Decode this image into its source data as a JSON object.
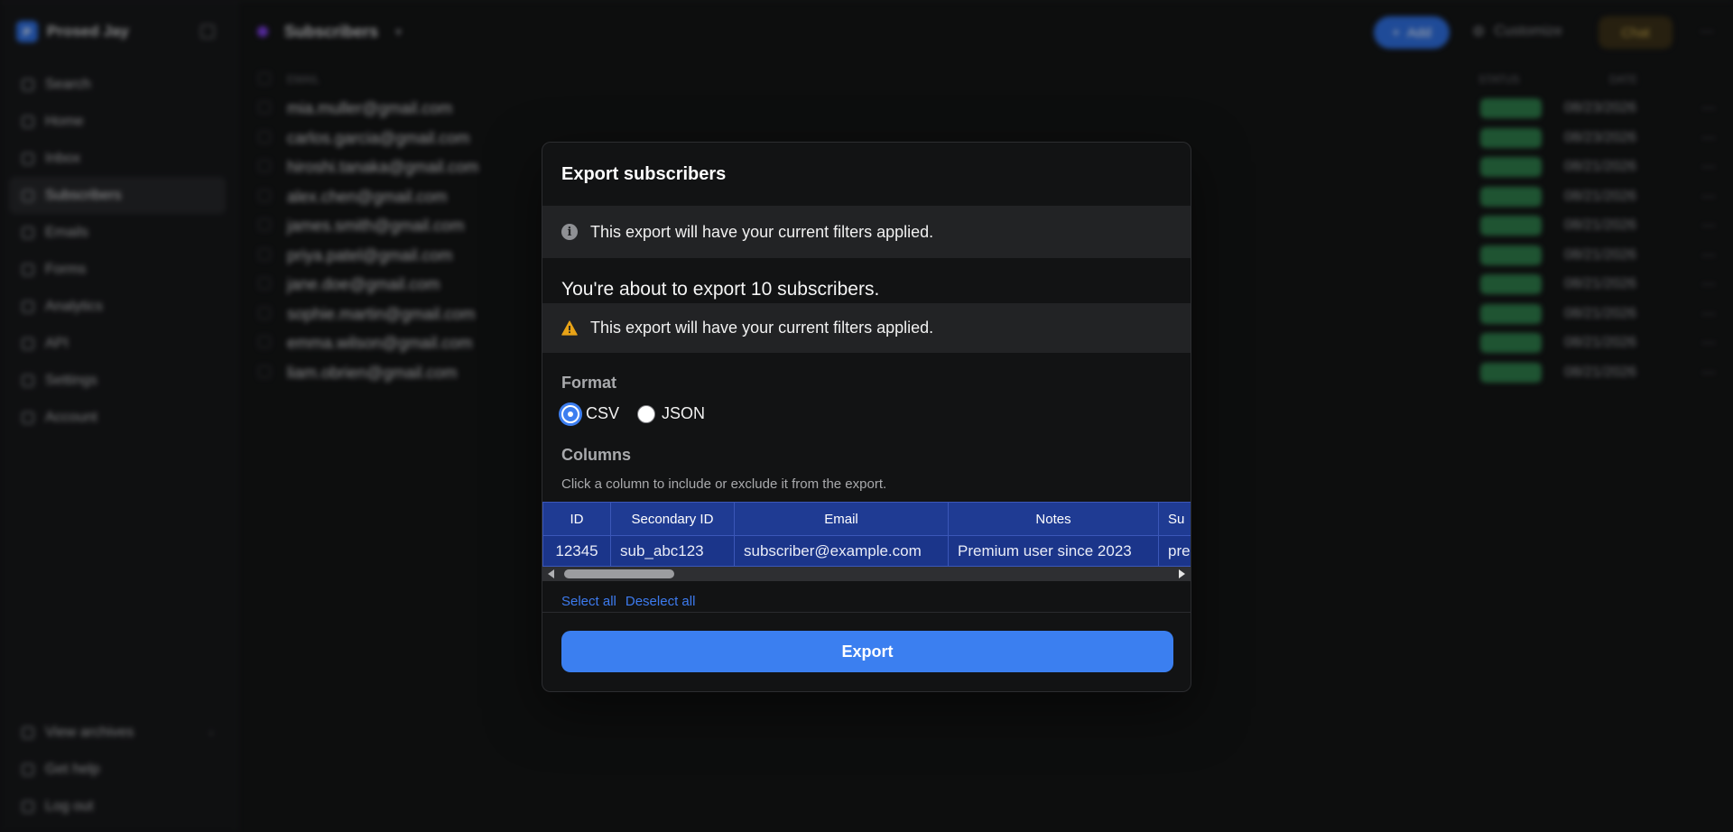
{
  "workspace": {
    "initial": "P",
    "name": "Prosed Jay"
  },
  "sidebar": {
    "items": [
      {
        "label": "Search"
      },
      {
        "label": "Home"
      },
      {
        "label": "Inbox"
      },
      {
        "label": "Subscribers"
      },
      {
        "label": "Emails"
      },
      {
        "label": "Forms"
      },
      {
        "label": "Analytics"
      },
      {
        "label": "API"
      },
      {
        "label": "Settings"
      },
      {
        "label": "Account"
      }
    ],
    "bottom": [
      {
        "label": "View archives"
      },
      {
        "label": "Get help"
      },
      {
        "label": "Log out"
      }
    ]
  },
  "header": {
    "title": "Subscribers",
    "add_label": "Add",
    "customize_label": "Customize",
    "chat_label": "Chat"
  },
  "table": {
    "headers": {
      "email": "EMAIL",
      "status": "STATUS",
      "date": "DATE"
    },
    "rows": [
      {
        "email": "mia.muller@gmail.com",
        "date": "08/23/2026"
      },
      {
        "email": "carlos.garcia@gmail.com",
        "date": "08/23/2026"
      },
      {
        "email": "hiroshi.tanaka@gmail.com",
        "date": "08/21/2026"
      },
      {
        "email": "alex.chen@gmail.com",
        "date": "08/21/2026"
      },
      {
        "email": "james.smith@gmail.com",
        "date": "08/21/2026"
      },
      {
        "email": "priya.patel@gmail.com",
        "date": "08/21/2026"
      },
      {
        "email": "jane.doe@gmail.com",
        "date": "08/21/2026"
      },
      {
        "email": "sophie.martin@gmail.com",
        "date": "08/21/2026"
      },
      {
        "email": "emma.wilson@gmail.com",
        "date": "08/21/2026"
      },
      {
        "email": "liam.obrien@gmail.com",
        "date": "08/21/2026"
      }
    ]
  },
  "modal": {
    "title": "Export subscribers",
    "info_banner": "This export will have your current filters applied.",
    "count_text": "You're about to export 10 subscribers.",
    "warning_banner": "This export will have your current filters applied.",
    "format_label": "Format",
    "format_options": [
      "CSV",
      "JSON"
    ],
    "format_selected": "CSV",
    "columns_label": "Columns",
    "columns_hint": "Click a column to include or exclude it from the export.",
    "columns": [
      {
        "header": "ID",
        "sample": "12345"
      },
      {
        "header": "Secondary ID",
        "sample": "sub_abc123"
      },
      {
        "header": "Email",
        "sample": "subscriber@example.com"
      },
      {
        "header": "Notes",
        "sample": "Premium user since 2023"
      },
      {
        "header": "Su",
        "sample": "pre"
      }
    ],
    "select_all": "Select all",
    "deselect_all": "Deselect all",
    "export_label": "Export"
  },
  "colors": {
    "accent": "#3b7ff0",
    "column_header": "#1f3b93",
    "warning": "#e8a317",
    "status_badge": "#2e7d4b"
  }
}
